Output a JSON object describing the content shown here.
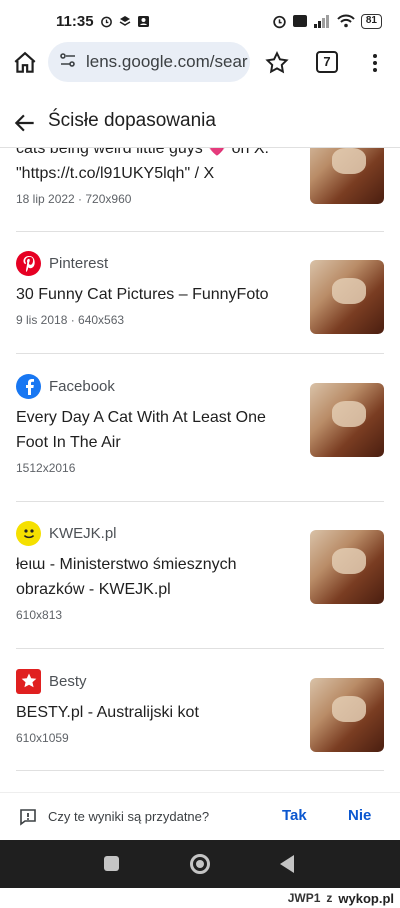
{
  "status_bar": {
    "time": "11:35",
    "battery": "81"
  },
  "browser": {
    "url": "lens.google.com/sear",
    "tab_count": "7"
  },
  "page": {
    "title": "Ścisłe dopasowania"
  },
  "results": [
    {
      "source": "",
      "title": "cats being weird little guys 💗 on X: \"https://t.co/l91UKY5lqh\" / X",
      "meta": "18 lip 2022 · 720x960",
      "logo": "x-logo",
      "logo_color": "#000000"
    },
    {
      "source": "Pinterest",
      "title": "30 Funny Cat Pictures – FunnyFoto",
      "meta": "9 lis 2018 · 640x563",
      "logo": "pinterest-logo",
      "logo_color": "#e60023"
    },
    {
      "source": "Facebook",
      "title": "Every Day A Cat With At Least One Foot In The Air",
      "meta": "1512x2016",
      "logo": "facebook-logo",
      "logo_color": "#1877f2"
    },
    {
      "source": "KWEJK.pl",
      "title": "łеιɯ - Ministerstwo śmiesznych obrazków - KWEJK.pl",
      "meta": "610x813",
      "logo": "kwejk-logo",
      "logo_color": "#f5e000"
    },
    {
      "source": "Besty",
      "title": "BESTY.pl - Australijski kot",
      "meta": "610x1059",
      "logo": "besty-logo",
      "logo_color": "#e02020"
    }
  ],
  "feedback": {
    "question": "Czy te wyniki są przydatne?",
    "yes": "Tak",
    "no": "Nie"
  },
  "watermark": {
    "user": "JWP1",
    "z": "z",
    "site": "wykop.pl"
  }
}
